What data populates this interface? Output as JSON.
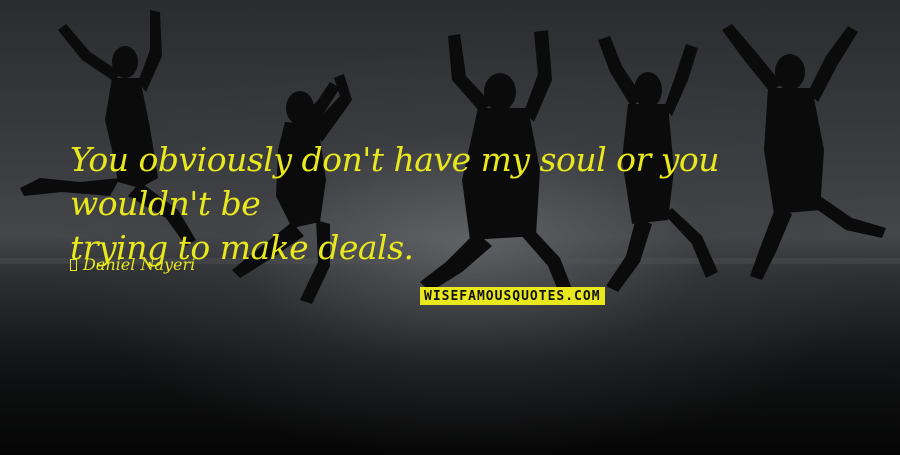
{
  "quote": {
    "line1": "You obviously don't have my soul or you wouldn't be",
    "line2": "trying to make deals."
  },
  "author": "Daniel Nayeri",
  "watermark": "WISEFAMOUSQUOTES.COM",
  "colors": {
    "text": "#e9e81c",
    "silhouette": "#0b0b0b"
  }
}
